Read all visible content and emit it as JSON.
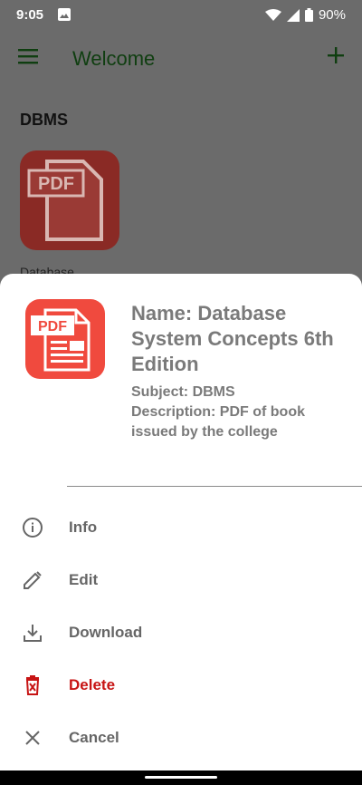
{
  "status": {
    "time": "9:05",
    "battery": "90%",
    "icons": [
      "image-icon",
      "wifi-icon",
      "signal-icon",
      "battery-icon"
    ]
  },
  "appbar": {
    "title": "Welcome",
    "menu_icon": "hamburger-menu-icon",
    "add_icon": "plus-icon"
  },
  "background": {
    "section_title": "DBMS",
    "file_label": "Database"
  },
  "sheet": {
    "name": "Name: Database System Concepts 6th Edition",
    "subject": "Subject: DBMS",
    "description": "Description: PDF of book issued by the college",
    "icon_text": "PDF",
    "menu": [
      {
        "label": "Info",
        "icon": "info-icon"
      },
      {
        "label": "Edit",
        "icon": "pencil-icon"
      },
      {
        "label": "Download",
        "icon": "download-icon"
      },
      {
        "label": "Delete",
        "icon": "trash-icon"
      },
      {
        "label": "Cancel",
        "icon": "close-icon"
      }
    ]
  },
  "colors": {
    "accent_green": "#0f3e10",
    "delete_red": "#c71414",
    "pdf_red": "#f04a3e"
  }
}
